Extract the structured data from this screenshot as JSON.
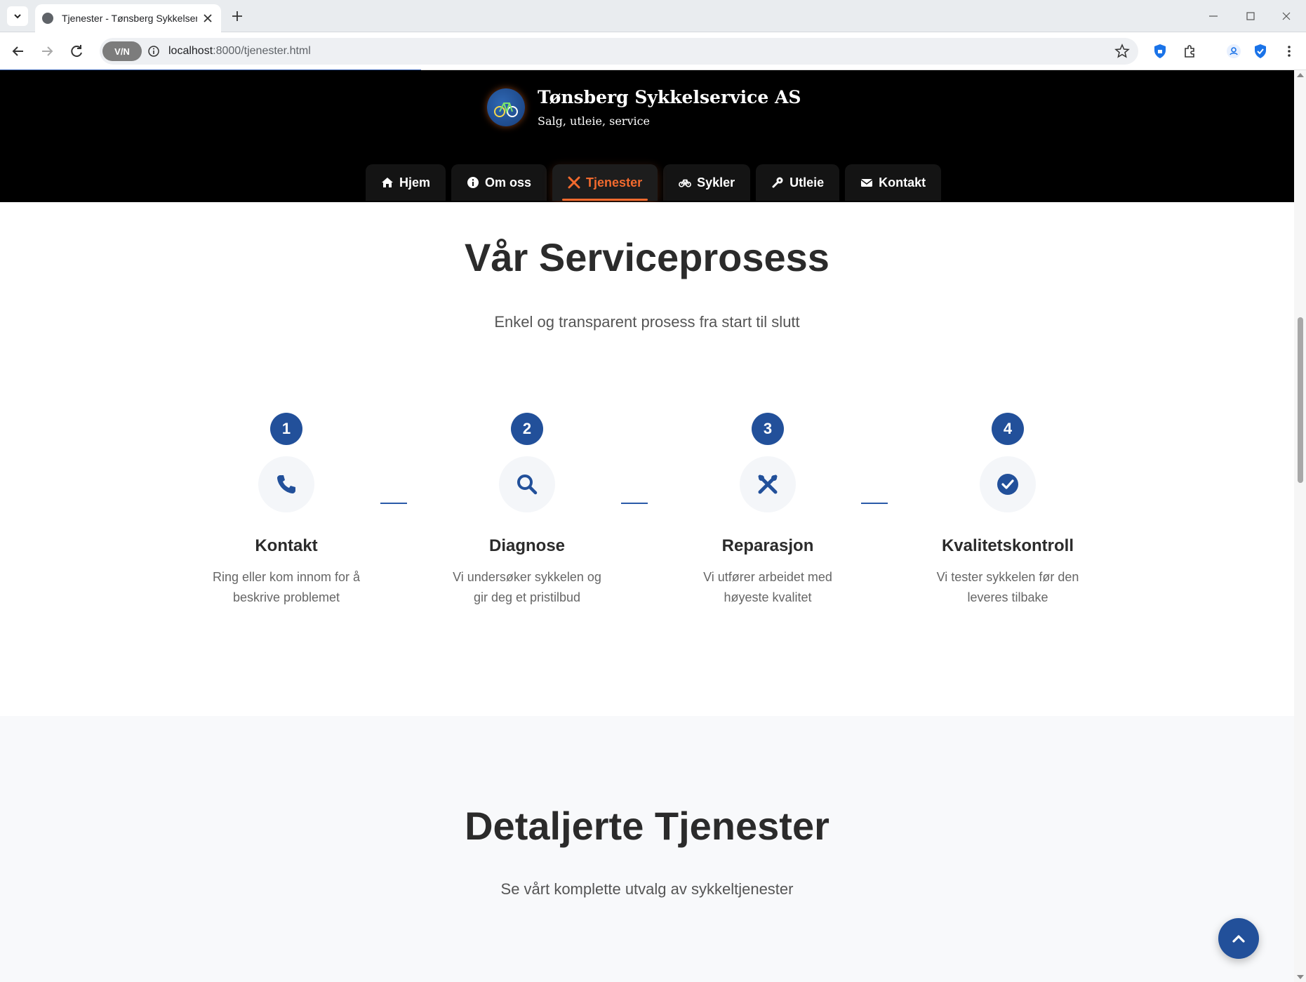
{
  "browser": {
    "tab_title": "Tjenester - Tønsberg Sykkelservice",
    "url_host": "localhost",
    "url_rest": ":8000/tjenester.html",
    "vpn_label": "V/N"
  },
  "site": {
    "brand_name": "Tønsberg Sykkelservice AS",
    "brand_tagline": "Salg, utleie, service",
    "nav": [
      {
        "label": "Hjem",
        "icon": "home-icon"
      },
      {
        "label": "Om oss",
        "icon": "info-icon"
      },
      {
        "label": "Tjenester",
        "icon": "tools-icon",
        "active": true
      },
      {
        "label": "Sykler",
        "icon": "bicycle-icon"
      },
      {
        "label": "Utleie",
        "icon": "wrench-icon"
      },
      {
        "label": "Kontakt",
        "icon": "envelope-icon"
      }
    ],
    "accent_color": "#f26a2e",
    "brand_blue": "#22509a"
  },
  "process": {
    "title": "Vår Serviceprosess",
    "subtitle": "Enkel og transparent prosess fra start til slutt",
    "steps": [
      {
        "number": "1",
        "icon": "phone-icon",
        "title": "Kontakt",
        "desc": "Ring eller kom innom for å beskrive problemet"
      },
      {
        "number": "2",
        "icon": "search-icon",
        "title": "Diagnose",
        "desc": "Vi undersøker sykkelen og gir deg et pristilbud"
      },
      {
        "number": "3",
        "icon": "tools-icon",
        "title": "Reparasjon",
        "desc": "Vi utfører arbeidet med høyeste kvalitet"
      },
      {
        "number": "4",
        "icon": "check-circle-icon",
        "title": "Kvalitetskontroll",
        "desc": "Vi tester sykkelen før den leveres tilbake"
      }
    ]
  },
  "detailed": {
    "title": "Detaljerte Tjenester",
    "subtitle": "Se vårt komplette utvalg av sykkeltjenester"
  }
}
